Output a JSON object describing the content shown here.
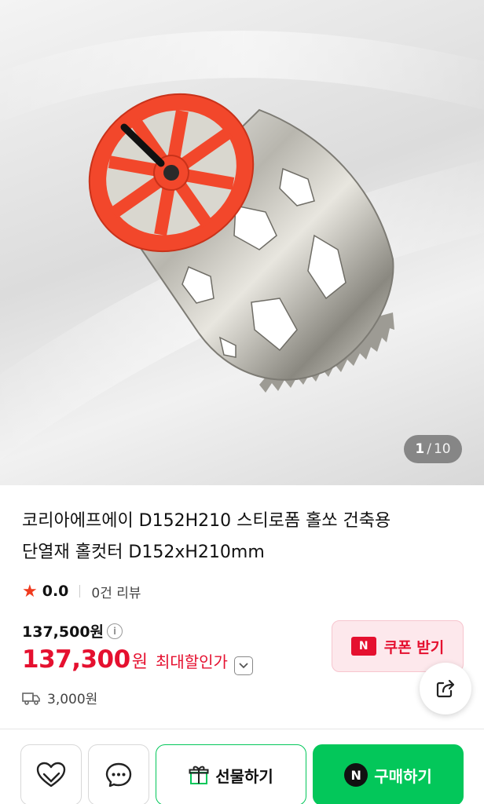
{
  "gallery": {
    "current_index": "1",
    "separator": "/",
    "total": "10"
  },
  "product": {
    "title_line1": "코리아에프에이 D152H210 스티로폼 홀쏘 건축용",
    "title_line2": "단열재 홀컷터 D152xH210mm"
  },
  "rating": {
    "score": "0.0",
    "reviews": "0건 리뷰"
  },
  "price": {
    "original": "137,500원",
    "sale": "137,300",
    "sale_unit": "원",
    "sale_label": "최대할인가"
  },
  "coupon": {
    "badge": "N",
    "label": "쿠폰 받기"
  },
  "shipping": {
    "fee": "3,000원"
  },
  "actions": {
    "gift_label": "선물하기",
    "buy_badge": "N",
    "buy_label": "구매하기"
  },
  "icons": [
    "star-icon",
    "info-icon",
    "chevron-down-icon",
    "share-icon",
    "truck-icon",
    "heart-icon",
    "chat-icon",
    "gift-icon"
  ],
  "colors": {
    "sale_red": "#e5102f",
    "naver_green": "#03c75a",
    "star": "#f03a1e",
    "product_red": "#f2472b"
  }
}
